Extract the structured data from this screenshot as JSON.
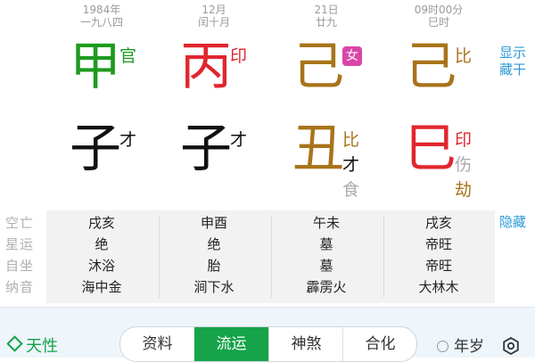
{
  "columns": [
    {
      "date_top": "1984年",
      "date_bottom": "一九八四",
      "stem": "甲",
      "stem_god": "官",
      "branch": "子",
      "branch_hidden": [
        "才"
      ]
    },
    {
      "date_top": "12月",
      "date_bottom": "闰十月",
      "stem": "丙",
      "stem_god": "印",
      "branch": "子",
      "branch_hidden": [
        "才"
      ]
    },
    {
      "date_top": "21日",
      "date_bottom": "廿九",
      "stem": "己",
      "stem_god": "女",
      "branch": "丑",
      "branch_hidden": [
        "比",
        "才",
        "食"
      ]
    },
    {
      "date_top": "09时00分",
      "date_bottom": "巳时",
      "stem": "己",
      "stem_god": "比",
      "branch": "巳",
      "branch_hidden": [
        "印",
        "伤",
        "劫"
      ]
    }
  ],
  "side": {
    "show_label": "显示",
    "hidden_stems_label": "藏干",
    "hide_label": "隐藏"
  },
  "row_labels": [
    "空亡",
    "星运",
    "自坐",
    "纳音"
  ],
  "rows": [
    [
      "戌亥",
      "申酉",
      "午未",
      "戌亥"
    ],
    [
      "绝",
      "绝",
      "墓",
      "帝旺"
    ],
    [
      "沐浴",
      "胎",
      "墓",
      "帝旺"
    ],
    [
      "海中金",
      "涧下水",
      "霹雳火",
      "大林木"
    ]
  ],
  "bottom": {
    "tianxing_label": "天性",
    "tabs": [
      "资料",
      "流运",
      "神煞",
      "合化"
    ],
    "active_tab": "流运",
    "year_label": "年岁"
  },
  "colors": {
    "wood": "#1e9b1e",
    "fire": "#e0262e",
    "earth": "#a8741a",
    "water": "#111111",
    "active_tab": "#16a34a",
    "gender_badge": "#d946a8",
    "link": "#2e9ad8"
  },
  "icons": [
    "diamond-icon",
    "radio-circle-icon",
    "settings-icon"
  ]
}
